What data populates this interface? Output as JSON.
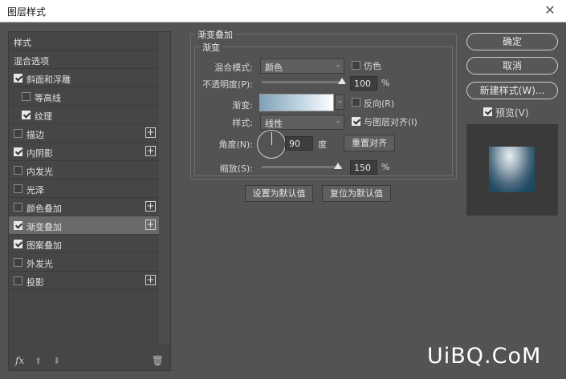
{
  "window": {
    "title": "图层样式",
    "close": "✕"
  },
  "left": {
    "header": "样式",
    "blend_options": "混合选项",
    "items": [
      {
        "label": "斜面和浮雕",
        "checked": true
      },
      {
        "label": "等高线",
        "checked": false
      },
      {
        "label": "纹理",
        "checked": true
      },
      {
        "label": "描边",
        "checked": false,
        "plus": true
      },
      {
        "label": "内阴影",
        "checked": true,
        "plus": true
      },
      {
        "label": "内发光",
        "checked": false
      },
      {
        "label": "光泽",
        "checked": false
      },
      {
        "label": "颜色叠加",
        "checked": false,
        "plus": true
      },
      {
        "label": "渐变叠加",
        "checked": true,
        "plus": true,
        "selected": true
      },
      {
        "label": "图案叠加",
        "checked": true
      },
      {
        "label": "外发光",
        "checked": false
      },
      {
        "label": "投影",
        "checked": false,
        "plus": true
      }
    ],
    "footer": {
      "fx": "fx",
      "up": "⬆",
      "down": "⬇",
      "trash": "🗑"
    }
  },
  "gradient_overlay": {
    "group_title": "渐变叠加",
    "sub_title": "渐变",
    "blend_mode_label": "混合模式:",
    "blend_mode_value": "颜色",
    "dither_label": "仿色",
    "opacity_label": "不透明度(P):",
    "opacity_value": "100",
    "opacity_unit": "%",
    "opacity_level": 100,
    "gradient_label": "渐变:",
    "reverse_label": "反向(R)",
    "style_label": "样式:",
    "style_value": "线性",
    "align_label": "与图层对齐(I)",
    "angle_label": "角度(N):",
    "angle_value": "90",
    "angle_unit": "度",
    "reset_align_button": "重置对齐",
    "scale_label": "缩放(S):",
    "scale_value": "150",
    "scale_unit": "%",
    "set_default_button": "设置为默认值",
    "reset_default_button": "复位为默认值"
  },
  "right": {
    "ok": "确定",
    "cancel": "取消",
    "new_style": "新建样式(W)...",
    "preview_label": "预览(V)",
    "preview_checked": true
  },
  "watermark": "UiBQ.CoM",
  "colors": {
    "bg": "#535353",
    "panel": "#464646",
    "selected_row": "#6a6a6a"
  }
}
